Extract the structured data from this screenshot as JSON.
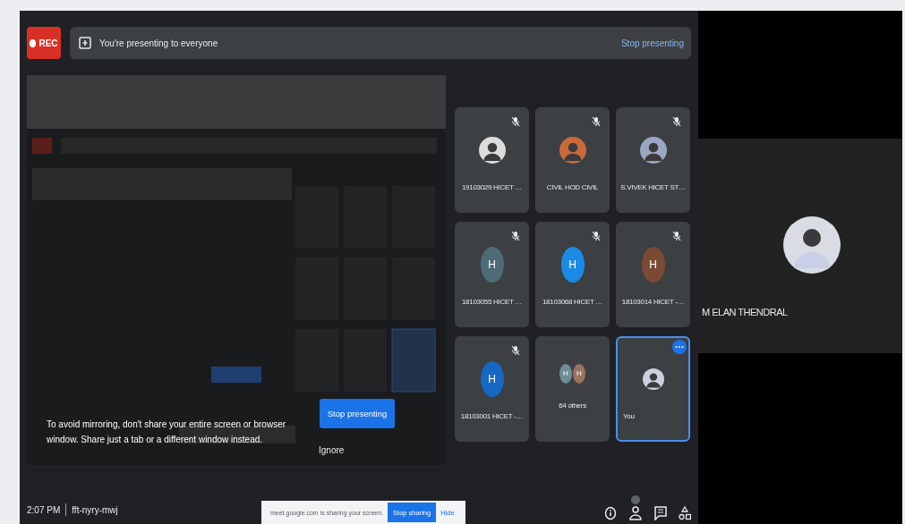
{
  "recording": {
    "label": "REC"
  },
  "banner": {
    "text": "You're presenting to everyone",
    "action": "Stop presenting"
  },
  "participants": [
    {
      "name": "19103029 HICET …",
      "kind": "photo",
      "color": "#dcdcdc",
      "muted": true,
      "selected": false
    },
    {
      "name": "CIVIL HOD CIVIL",
      "kind": "photo",
      "color": "#c96a3c",
      "muted": true,
      "selected": false
    },
    {
      "name": "S.VIVEK HICET ST…",
      "kind": "photo",
      "color": "#9aa6c4",
      "muted": true,
      "selected": false
    },
    {
      "name": "18103055 HICET …",
      "kind": "letter",
      "letter": "H",
      "color": "#4f6b77",
      "muted": true,
      "selected": false
    },
    {
      "name": "18103068 HICET …",
      "kind": "letter",
      "letter": "H",
      "color": "#1a8ae6",
      "muted": true,
      "selected": false
    },
    {
      "name": "18103014 HICET -…",
      "kind": "letter",
      "letter": "H",
      "color": "#7a4a34",
      "muted": true,
      "selected": false
    },
    {
      "name": "18103001 HICET -…",
      "kind": "letter",
      "letter": "H",
      "color": "#1668c2",
      "muted": true,
      "selected": false
    },
    {
      "name": "64 others",
      "kind": "others",
      "avatars": [
        {
          "letter": "H",
          "color": "#6f8d99"
        },
        {
          "letter": "H",
          "color": "#9a7460"
        }
      ],
      "muted": false,
      "selected": false
    },
    {
      "name": "You",
      "kind": "self",
      "color": "#c9d1dc",
      "muted": false,
      "selected": true
    }
  ],
  "mirror_prompt": {
    "message": "To avoid mirroring, don't share your entire screen or browser window. Share just a tab or a different window instead.",
    "primary": "Stop presenting",
    "secondary": "Ignore"
  },
  "meeting": {
    "time": "2:07 PM",
    "code": "fft-nyry-mwj"
  },
  "share_bar": {
    "text": "meet.google.com is sharing your screen.",
    "button": "Stop sharing",
    "link": "Hide"
  },
  "speaker": {
    "name": "M ELAN THENDRAL"
  }
}
